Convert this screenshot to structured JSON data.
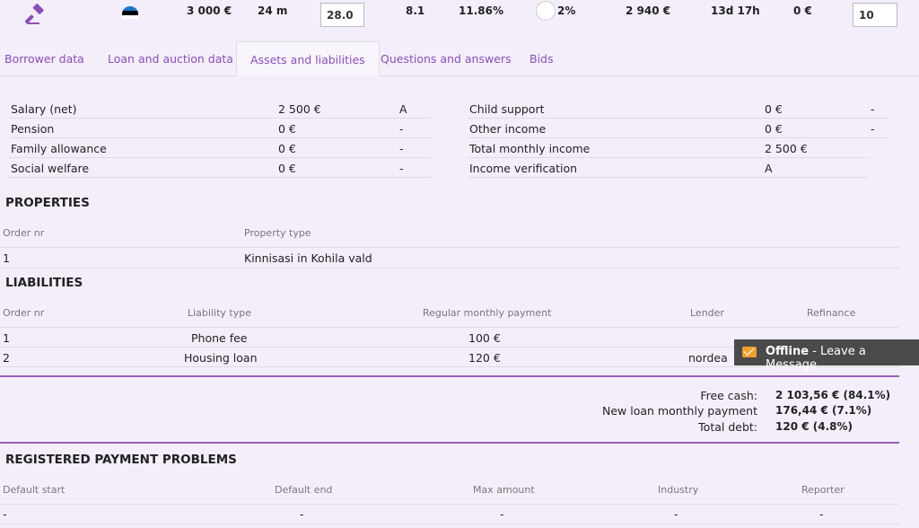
{
  "stats": {
    "amount": "3 000 €",
    "term": "24 m",
    "rate_input": "28.0",
    "score": "8.1",
    "interest": "11.86%",
    "funded": "2%",
    "total": "2 940 €",
    "time_left": "13d 17h",
    "bid": "0 €",
    "bid_input": "10"
  },
  "tabs": [
    {
      "label": "Borrower data"
    },
    {
      "label": "Loan and auction data"
    },
    {
      "label": "Assets and liabilities"
    },
    {
      "label": "Questions and answers"
    },
    {
      "label": "Bids"
    }
  ],
  "income_left": [
    {
      "label": "Salary (net)",
      "value": "2 500 €",
      "flag": "A"
    },
    {
      "label": "Pension",
      "value": "0 €",
      "flag": "-"
    },
    {
      "label": "Family allowance",
      "value": "0 €",
      "flag": "-"
    },
    {
      "label": "Social welfare",
      "value": "0 €",
      "flag": "-"
    }
  ],
  "income_right": [
    {
      "label": "Child support",
      "value": "0 €",
      "flag": "-"
    },
    {
      "label": "Other income",
      "value": "0 €",
      "flag": "-"
    },
    {
      "label": "Total monthly income",
      "value": "2 500 €",
      "flag": ""
    },
    {
      "label": "Income verification",
      "value": "A",
      "flag": ""
    }
  ],
  "properties": {
    "title": "PROPERTIES",
    "headers": [
      "Order nr",
      "Property type"
    ],
    "rows": [
      [
        "1",
        "Kinnisasi in Kohila vald"
      ]
    ]
  },
  "liabilities": {
    "title": "LIABILITIES",
    "headers": [
      "Order nr",
      "Liability type",
      "Regular monthly payment",
      "Lender",
      "Refinance"
    ],
    "rows": [
      [
        "1",
        "Phone fee",
        "100 €",
        "",
        ""
      ],
      [
        "2",
        "Housing loan",
        "120 €",
        "nordea",
        ""
      ]
    ]
  },
  "summary": [
    {
      "label": "Free cash:",
      "value": "2 103,56 € (84.1%)"
    },
    {
      "label": "New loan monthly payment",
      "value": "176,44 € (7.1%)"
    },
    {
      "label": "Total debt:",
      "value": "120 € (4.8%)"
    }
  ],
  "payment_problems": {
    "title": "REGISTERED PAYMENT PROBLEMS",
    "headers": [
      "Default start",
      "Default end",
      "Max amount",
      "Industry",
      "Reporter"
    ],
    "rows": [
      [
        "-",
        "-",
        "-",
        "-",
        "-"
      ]
    ]
  },
  "chat": {
    "bold": "Offline",
    "rest": " - Leave a Message"
  },
  "colors": {
    "accent": "#8a4fb6",
    "divider": "#9a62b5",
    "background": "#f4eefb"
  }
}
